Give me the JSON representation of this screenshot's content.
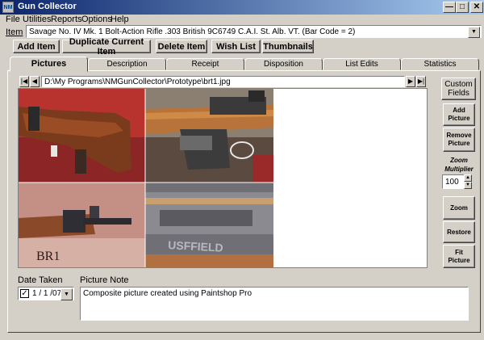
{
  "window": {
    "title": "Gun Collector",
    "icon_text": "NM"
  },
  "menu": [
    "File",
    "Utilities",
    "Reports",
    "Options",
    "Help"
  ],
  "item": {
    "label": "Item",
    "value": "Savage No. IV Mk. 1 Bolt-Action Rifle .303 British 9C6749 C.A.I. St. Alb. VT. (Bar Code = 2)"
  },
  "toolbar": {
    "add": "Add Item",
    "duplicate": "Duplicate Current Item",
    "delete": "Delete Item",
    "wishlist": "Wish List",
    "thumbnails": "Thumbnails"
  },
  "tabs": [
    "Pictures",
    "Description",
    "Receipt",
    "Disposition",
    "List Edits",
    "Statistics"
  ],
  "active_tab": "Pictures",
  "picture": {
    "path": "D:\\My Programs\\NMGunCollector\\Prototype\\brt1.jpg",
    "watermark": "BR1"
  },
  "side": {
    "custom_fields": "Custom Fields",
    "add_picture": "Add Picture",
    "remove_picture": "Remove Picture",
    "zoom_label": "Zoom Multiplier",
    "zoom_value": "100",
    "zoom": "Zoom",
    "restore": "Restore",
    "fit_picture": "Fit Picture"
  },
  "date_taken": {
    "label": "Date Taken",
    "value": "1 / 1 /07",
    "checked": true
  },
  "picture_note": {
    "label": "Picture Note",
    "value": "Composite picture created using Paintshop Pro"
  }
}
